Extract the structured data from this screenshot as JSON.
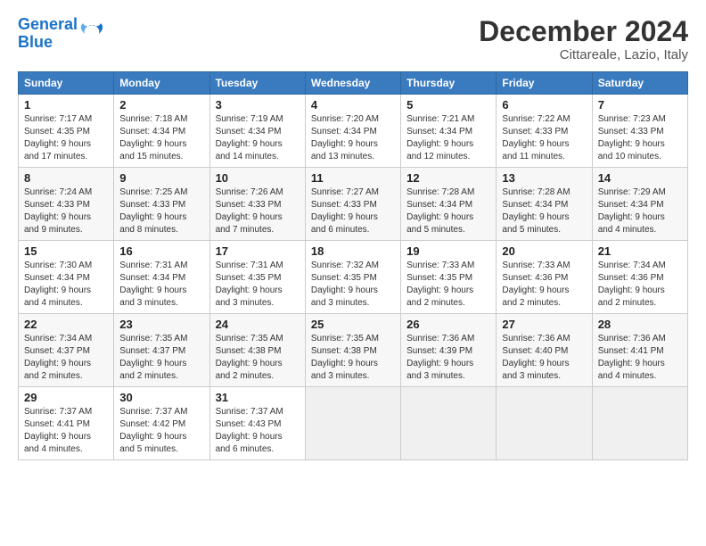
{
  "header": {
    "logo_line1": "General",
    "logo_line2": "Blue",
    "main_title": "December 2024",
    "subtitle": "Cittareale, Lazio, Italy"
  },
  "columns": [
    "Sunday",
    "Monday",
    "Tuesday",
    "Wednesday",
    "Thursday",
    "Friday",
    "Saturday"
  ],
  "weeks": [
    [
      {
        "day": "1",
        "info": "Sunrise: 7:17 AM\nSunset: 4:35 PM\nDaylight: 9 hours\nand 17 minutes."
      },
      {
        "day": "2",
        "info": "Sunrise: 7:18 AM\nSunset: 4:34 PM\nDaylight: 9 hours\nand 15 minutes."
      },
      {
        "day": "3",
        "info": "Sunrise: 7:19 AM\nSunset: 4:34 PM\nDaylight: 9 hours\nand 14 minutes."
      },
      {
        "day": "4",
        "info": "Sunrise: 7:20 AM\nSunset: 4:34 PM\nDaylight: 9 hours\nand 13 minutes."
      },
      {
        "day": "5",
        "info": "Sunrise: 7:21 AM\nSunset: 4:34 PM\nDaylight: 9 hours\nand 12 minutes."
      },
      {
        "day": "6",
        "info": "Sunrise: 7:22 AM\nSunset: 4:33 PM\nDaylight: 9 hours\nand 11 minutes."
      },
      {
        "day": "7",
        "info": "Sunrise: 7:23 AM\nSunset: 4:33 PM\nDaylight: 9 hours\nand 10 minutes."
      }
    ],
    [
      {
        "day": "8",
        "info": "Sunrise: 7:24 AM\nSunset: 4:33 PM\nDaylight: 9 hours\nand 9 minutes."
      },
      {
        "day": "9",
        "info": "Sunrise: 7:25 AM\nSunset: 4:33 PM\nDaylight: 9 hours\nand 8 minutes."
      },
      {
        "day": "10",
        "info": "Sunrise: 7:26 AM\nSunset: 4:33 PM\nDaylight: 9 hours\nand 7 minutes."
      },
      {
        "day": "11",
        "info": "Sunrise: 7:27 AM\nSunset: 4:33 PM\nDaylight: 9 hours\nand 6 minutes."
      },
      {
        "day": "12",
        "info": "Sunrise: 7:28 AM\nSunset: 4:34 PM\nDaylight: 9 hours\nand 5 minutes."
      },
      {
        "day": "13",
        "info": "Sunrise: 7:28 AM\nSunset: 4:34 PM\nDaylight: 9 hours\nand 5 minutes."
      },
      {
        "day": "14",
        "info": "Sunrise: 7:29 AM\nSunset: 4:34 PM\nDaylight: 9 hours\nand 4 minutes."
      }
    ],
    [
      {
        "day": "15",
        "info": "Sunrise: 7:30 AM\nSunset: 4:34 PM\nDaylight: 9 hours\nand 4 minutes."
      },
      {
        "day": "16",
        "info": "Sunrise: 7:31 AM\nSunset: 4:34 PM\nDaylight: 9 hours\nand 3 minutes."
      },
      {
        "day": "17",
        "info": "Sunrise: 7:31 AM\nSunset: 4:35 PM\nDaylight: 9 hours\nand 3 minutes."
      },
      {
        "day": "18",
        "info": "Sunrise: 7:32 AM\nSunset: 4:35 PM\nDaylight: 9 hours\nand 3 minutes."
      },
      {
        "day": "19",
        "info": "Sunrise: 7:33 AM\nSunset: 4:35 PM\nDaylight: 9 hours\nand 2 minutes."
      },
      {
        "day": "20",
        "info": "Sunrise: 7:33 AM\nSunset: 4:36 PM\nDaylight: 9 hours\nand 2 minutes."
      },
      {
        "day": "21",
        "info": "Sunrise: 7:34 AM\nSunset: 4:36 PM\nDaylight: 9 hours\nand 2 minutes."
      }
    ],
    [
      {
        "day": "22",
        "info": "Sunrise: 7:34 AM\nSunset: 4:37 PM\nDaylight: 9 hours\nand 2 minutes."
      },
      {
        "day": "23",
        "info": "Sunrise: 7:35 AM\nSunset: 4:37 PM\nDaylight: 9 hours\nand 2 minutes."
      },
      {
        "day": "24",
        "info": "Sunrise: 7:35 AM\nSunset: 4:38 PM\nDaylight: 9 hours\nand 2 minutes."
      },
      {
        "day": "25",
        "info": "Sunrise: 7:35 AM\nSunset: 4:38 PM\nDaylight: 9 hours\nand 3 minutes."
      },
      {
        "day": "26",
        "info": "Sunrise: 7:36 AM\nSunset: 4:39 PM\nDaylight: 9 hours\nand 3 minutes."
      },
      {
        "day": "27",
        "info": "Sunrise: 7:36 AM\nSunset: 4:40 PM\nDaylight: 9 hours\nand 3 minutes."
      },
      {
        "day": "28",
        "info": "Sunrise: 7:36 AM\nSunset: 4:41 PM\nDaylight: 9 hours\nand 4 minutes."
      }
    ],
    [
      {
        "day": "29",
        "info": "Sunrise: 7:37 AM\nSunset: 4:41 PM\nDaylight: 9 hours\nand 4 minutes."
      },
      {
        "day": "30",
        "info": "Sunrise: 7:37 AM\nSunset: 4:42 PM\nDaylight: 9 hours\nand 5 minutes."
      },
      {
        "day": "31",
        "info": "Sunrise: 7:37 AM\nSunset: 4:43 PM\nDaylight: 9 hours\nand 6 minutes."
      },
      null,
      null,
      null,
      null
    ]
  ]
}
